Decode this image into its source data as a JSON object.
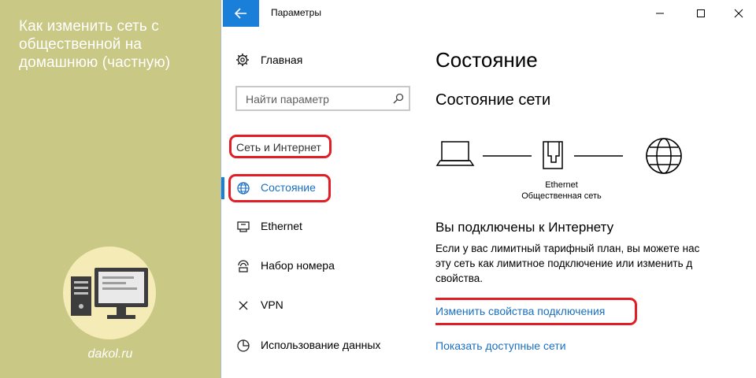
{
  "left_panel": {
    "caption": "Как изменить сеть с общественной на домашнюю (частную)",
    "site": "dakol.ru"
  },
  "window": {
    "title": "Параметры",
    "back_icon": "arrow-left-icon",
    "controls": [
      "minimize-icon",
      "maximize-icon",
      "close-icon"
    ]
  },
  "sidebar": {
    "home_label": "Главная",
    "search_placeholder": "Найти параметр",
    "section_header": "Сеть и Интернет",
    "items": [
      {
        "label": "Состояние",
        "icon": "globe-icon",
        "active": true
      },
      {
        "label": "Ethernet",
        "icon": "ethernet-icon"
      },
      {
        "label": "Набор номера",
        "icon": "dialup-icon"
      },
      {
        "label": "VPN",
        "icon": "vpn-icon"
      },
      {
        "label": "Использование данных",
        "icon": "data-usage-icon"
      }
    ]
  },
  "content": {
    "title": "Состояние",
    "subtitle": "Состояние сети",
    "diagram": {
      "adapter_name": "Ethernet",
      "network_type": "Общественная сеть"
    },
    "status_heading": "Вы подключены к Интернету",
    "body_lines": [
      "Если у вас лимитный тарифный план, вы можете нас",
      "эту сеть как лимитное подключение или изменить д",
      "свойства."
    ],
    "link_change": "Изменить свойства подключения",
    "link_show": "Показать доступные сети"
  },
  "colors": {
    "accent": "#1a7fd9",
    "highlight": "#e21d24",
    "left_panel": "#c9c885"
  }
}
